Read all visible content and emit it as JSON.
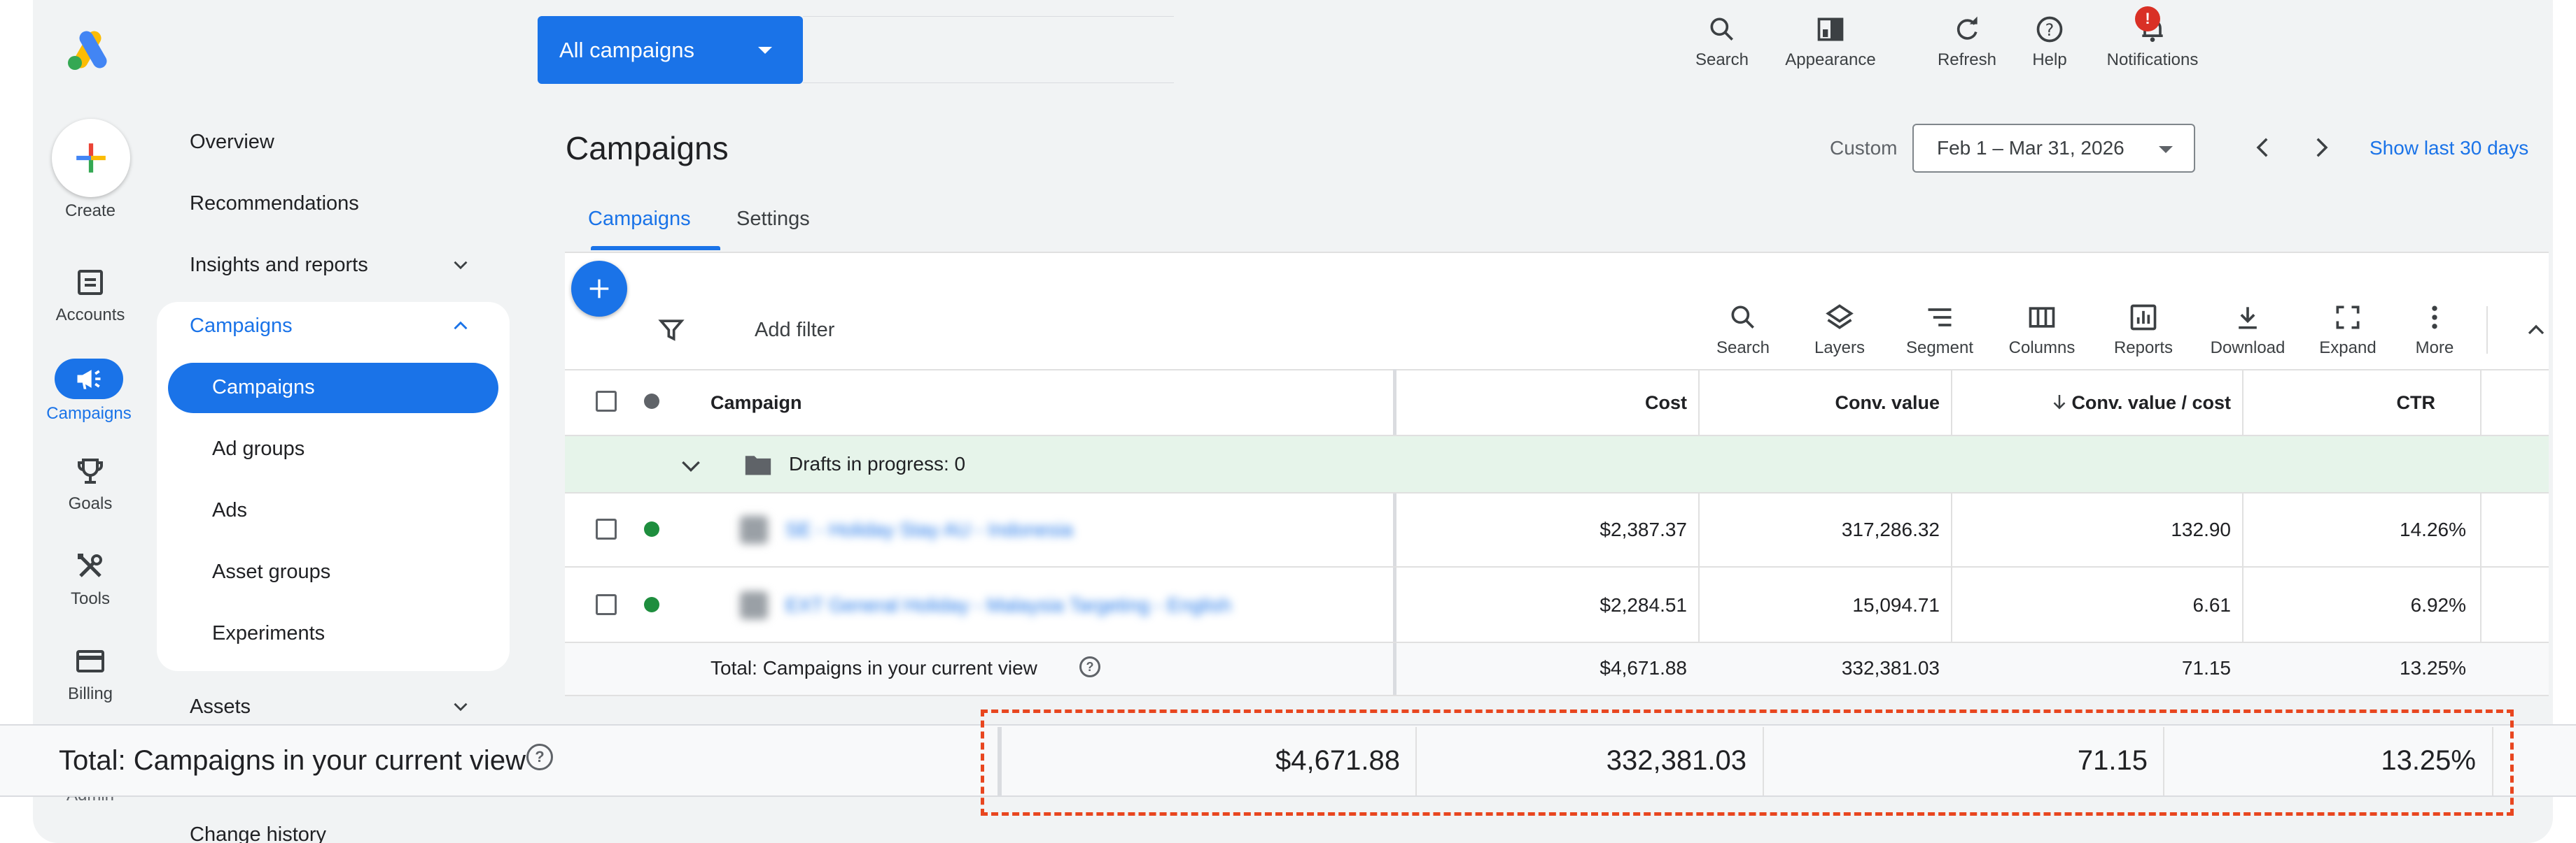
{
  "brand": {
    "accent": "#1a73e8",
    "highlight": "#e8461f",
    "success": "#1e8e3e",
    "error": "#d93025"
  },
  "topbar": {
    "campaign_selector": "All campaigns",
    "tools": [
      {
        "label": "Search",
        "icon": "search-icon"
      },
      {
        "label": "Appearance",
        "icon": "appearance-icon"
      },
      {
        "label": "Refresh",
        "icon": "refresh-icon"
      },
      {
        "label": "Help",
        "icon": "help-icon"
      },
      {
        "label": "Notifications",
        "icon": "bell-icon",
        "badge": "!"
      }
    ]
  },
  "rail": {
    "create": "Create",
    "items": [
      {
        "label": "Accounts",
        "icon": "accounts-icon"
      },
      {
        "label": "Campaigns",
        "icon": "megaphone-icon",
        "active": true
      },
      {
        "label": "Goals",
        "icon": "trophy-icon"
      },
      {
        "label": "Tools",
        "icon": "tools-icon"
      },
      {
        "label": "Billing",
        "icon": "billing-icon"
      },
      {
        "label": "Admin",
        "icon": "admin-icon"
      }
    ]
  },
  "nav": {
    "overview": "Overview",
    "recommendations": "Recommendations",
    "insights": "Insights and reports",
    "campaigns_group": "Campaigns",
    "sub": [
      "Campaigns",
      "Ad groups",
      "Ads",
      "Asset groups",
      "Experiments"
    ],
    "assets": "Assets",
    "change_history": "Change history"
  },
  "main": {
    "title": "Campaigns",
    "date_label": "Custom",
    "date_range": "Feb 1 – Mar 31, 2026",
    "show_last": "Show last 30 days",
    "tabs": [
      "Campaigns",
      "Settings"
    ],
    "add_filter": "Add filter",
    "toolbar": [
      {
        "label": "Search",
        "icon": "search-icon"
      },
      {
        "label": "Layers",
        "icon": "layers-icon"
      },
      {
        "label": "Segment",
        "icon": "segment-icon"
      },
      {
        "label": "Columns",
        "icon": "columns-icon"
      },
      {
        "label": "Reports",
        "icon": "reports-icon"
      },
      {
        "label": "Download",
        "icon": "download-icon"
      },
      {
        "label": "Expand",
        "icon": "expand-icon"
      },
      {
        "label": "More",
        "icon": "more-icon"
      }
    ]
  },
  "table": {
    "headers": {
      "campaign": "Campaign",
      "cost": "Cost",
      "conv_value": "Conv. value",
      "conv_value_cost": "Conv. value / cost",
      "ctr": "CTR"
    },
    "drafts": "Drafts in progress: 0",
    "rows": [
      {
        "name": "SE - Holiday Stay AU - Indonesia",
        "cost": "$2,387.37",
        "conv_value": "317,286.32",
        "conv_value_cost": "132.90",
        "ctr": "14.26%"
      },
      {
        "name": "EXT General Holiday - Malaysia Targeting - English",
        "cost": "$2,284.51",
        "conv_value": "15,094.71",
        "conv_value_cost": "6.61",
        "ctr": "6.92%"
      }
    ],
    "total": {
      "label": "Total: Campaigns in your current view",
      "cost": "$4,671.88",
      "conv_value": "332,381.03",
      "conv_value_cost": "71.15",
      "ctr": "13.25%"
    }
  },
  "sticky_total": {
    "label": "Total: Campaigns in your current view",
    "cost": "$4,671.88",
    "conv_value": "332,381.03",
    "conv_value_cost": "71.15",
    "ctr": "13.25%"
  }
}
